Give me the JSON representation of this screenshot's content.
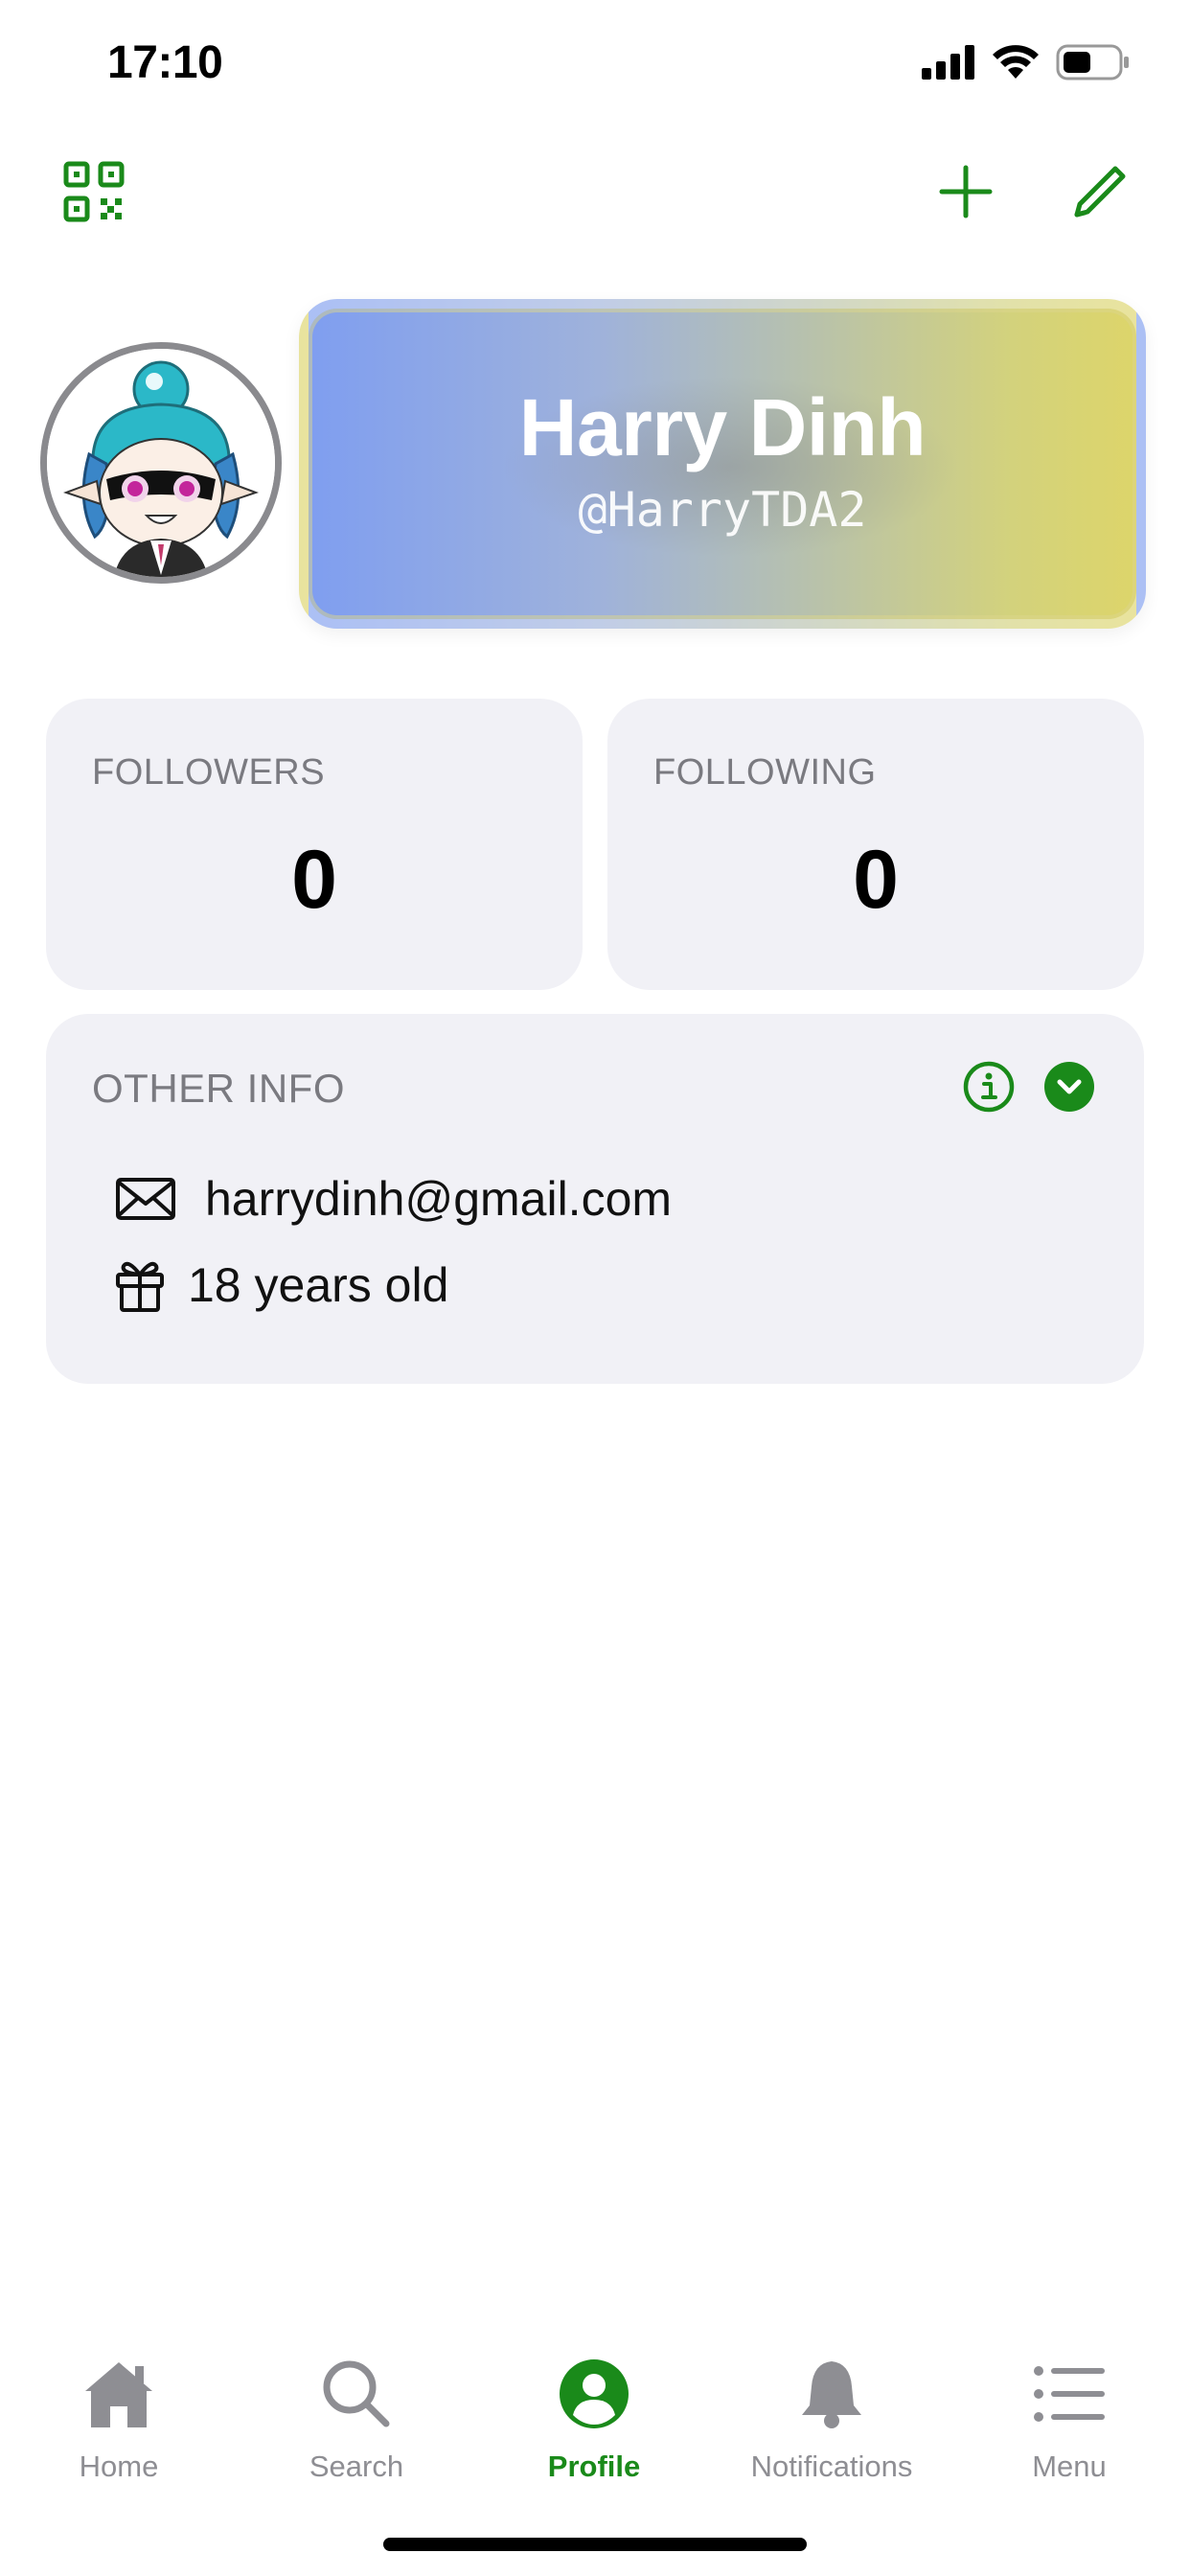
{
  "status_bar": {
    "time": "17:10",
    "battery_level": 0.45
  },
  "colors": {
    "accent": "#1a8a1a",
    "card_bg": "#f1f1f6",
    "label_gray": "#7a7a80",
    "tab_inactive": "#8e8e93"
  },
  "top_nav": {
    "left_icon": "qr-code-icon",
    "right_icons": [
      "plus-icon",
      "pencil-icon"
    ]
  },
  "profile": {
    "display_name": "Harry Dinh",
    "username": "@HarryTDA2"
  },
  "stats": {
    "followers_label": "FOLLOWERS",
    "followers_value": "0",
    "following_label": "FOLLOWING",
    "following_value": "0"
  },
  "other_info": {
    "label": "OTHER INFO",
    "email": "harrydinh@gmail.com",
    "age": "18 years old"
  },
  "tabs": [
    {
      "label": "Home",
      "icon": "house-icon"
    },
    {
      "label": "Search",
      "icon": "magnifier-icon"
    },
    {
      "label": "Profile",
      "icon": "person-circle-icon",
      "active": true
    },
    {
      "label": "Notifications",
      "icon": "bell-icon"
    },
    {
      "label": "Menu",
      "icon": "list-icon"
    }
  ]
}
